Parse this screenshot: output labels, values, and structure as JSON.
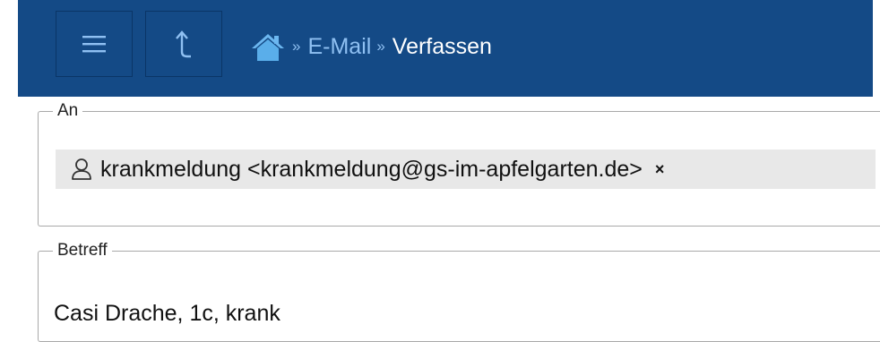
{
  "header": {
    "breadcrumb": {
      "separator": "»",
      "items": [
        "E-Mail",
        "Verfassen"
      ]
    },
    "icons": {
      "menu": "menu-icon",
      "up": "up-arrow-icon",
      "home": "home-icon"
    },
    "colors": {
      "background": "#144a86",
      "link": "#8fc0f2",
      "current": "#ffffff"
    }
  },
  "compose": {
    "to": {
      "legend": "An",
      "recipient": "krankmeldung <krankmeldung@gs-im-apfelgarten.de>",
      "remove_label": "×",
      "recipient_icon": "person-icon"
    },
    "subject": {
      "legend": "Betreff",
      "value": "Casi Drache, 1c, krank"
    }
  }
}
